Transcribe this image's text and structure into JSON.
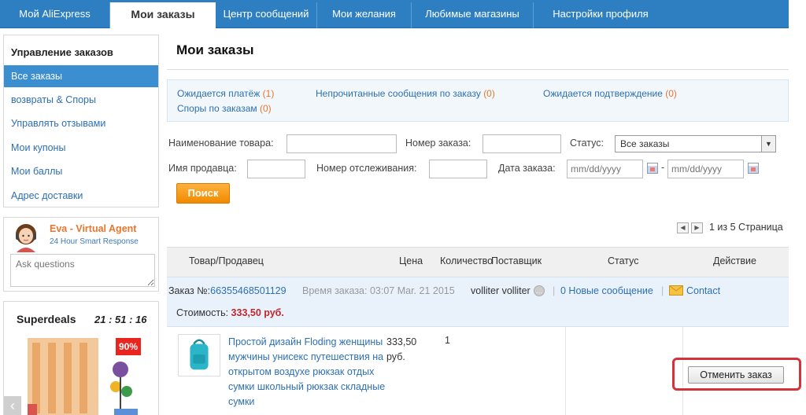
{
  "nav": {
    "tabs": [
      {
        "label": "Мой AliExpress"
      },
      {
        "label": "Мои заказы",
        "active": true
      },
      {
        "label": "Центр сообщений"
      },
      {
        "label": "Мои желания"
      },
      {
        "label": "Любимые магазины"
      },
      {
        "label": "Настройки профиля"
      }
    ]
  },
  "sidebar": {
    "heading": "Управление заказов",
    "items": [
      {
        "label": "Все заказы",
        "active": true
      },
      {
        "label": "возвраты & Споры"
      },
      {
        "label": "Управлять отзывами"
      },
      {
        "label": "Мои купоны"
      },
      {
        "label": "Мои баллы"
      },
      {
        "label": "Адрес доставки"
      }
    ]
  },
  "agent": {
    "name": "Eva - Virtual Agent",
    "subtitle": "24 Hour Smart Response",
    "placeholder": "Ask questions"
  },
  "superdeals": {
    "title": "Superdeals",
    "timer": "21 : 51 : 16",
    "badge": "90%"
  },
  "main": {
    "title": "Мои заказы",
    "summary": {
      "awaiting_payment": {
        "label": "Ожидается платёж",
        "count": "(1)"
      },
      "unread_messages": {
        "label": "Непрочитанные сообщения по заказу",
        "count": "(0)"
      },
      "awaiting_confirmation": {
        "label": "Ожидается подтверждение",
        "count": "(0)"
      },
      "disputes": {
        "label": "Споры по заказам",
        "count": "(0)"
      }
    },
    "filters": {
      "product_name_label": "Наименование товара:",
      "order_number_label": "Номер заказа:",
      "status_label": "Статус:",
      "status_value": "Все заказы",
      "seller_label": "Имя продавца:",
      "tracking_label": "Номер отслеживания:",
      "date_label": "Дата заказа:",
      "date_from_placeholder": "mm/dd/yyyy",
      "date_to_placeholder": "mm/dd/yyyy",
      "date_separator": "-",
      "search_button": "Поиск"
    },
    "pager": {
      "text": "1 из 5 Страница",
      "prev_icon": "chevron-left-icon",
      "next_icon": "chevron-right-icon"
    },
    "table_headers": {
      "product": "Товар/Продавец",
      "price": "Цена",
      "quantity": "Количество",
      "supplier": "Поставщик",
      "status": "Статус",
      "action": "Действие"
    },
    "order": {
      "number_label": "Заказ №:",
      "number": "66355468501129",
      "time_label": "Время заказа:",
      "time": "03:07 Mar. 21 2015",
      "seller": "volliter volliter",
      "separator": "|",
      "new_messages": "0 Новые сообщение",
      "contact": "Contact",
      "cost_label": "Стоимость:",
      "cost": "333,50 руб.",
      "item": {
        "title": "Простой дизайн Floding женщины мужчины унисекс путешествия на открытом воздухе рюкзак отдых сумки школьный рюкзак складные сумки",
        "price": "333,50 руб.",
        "quantity": "1"
      },
      "cancel_button": "Отменить заказ"
    }
  },
  "colors": {
    "nav_blue": "#2d7fc1",
    "link_blue": "#2d6fb3",
    "accent_orange": "#f08a00",
    "alert_red": "#d4323a"
  }
}
